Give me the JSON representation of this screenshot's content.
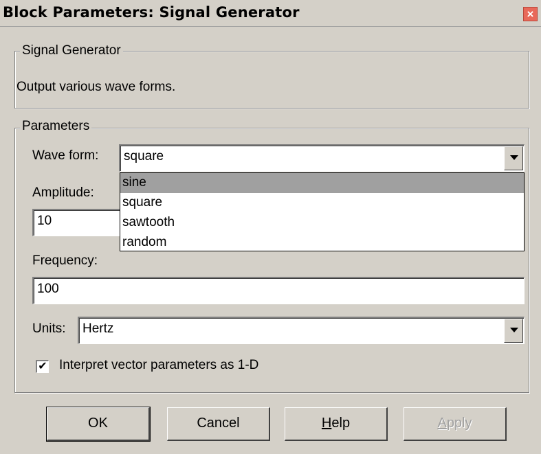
{
  "window": {
    "title": "Block Parameters: Signal Generator",
    "close_symbol": "×"
  },
  "description_group": {
    "legend": "Signal Generator",
    "text": "Output various wave forms."
  },
  "parameters_group": {
    "legend": "Parameters",
    "wave_form": {
      "label": "Wave form:",
      "value": "square",
      "options": [
        "sine",
        "square",
        "sawtooth",
        "random"
      ],
      "highlighted_option": "sine"
    },
    "amplitude": {
      "label": "Amplitude:",
      "value": "10"
    },
    "frequency": {
      "label": "Frequency:",
      "value": "100"
    },
    "units": {
      "label": "Units:",
      "value": "Hertz"
    },
    "interpret_vector": {
      "label": "Interpret vector parameters as 1-D",
      "checked": true,
      "check_mark": "✔"
    }
  },
  "buttons": {
    "ok": "OK",
    "cancel": "Cancel",
    "help_mnemonic": "H",
    "help_rest": "elp",
    "apply_mnemonic": "A",
    "apply_rest": "pply"
  },
  "icons": {
    "close": "close-icon",
    "dropdown": "chevron-down-icon",
    "check": "check-icon"
  },
  "colors": {
    "face": "#d4d0c8",
    "close_button": "#e8695a",
    "highlight": "#a0a0a0"
  }
}
